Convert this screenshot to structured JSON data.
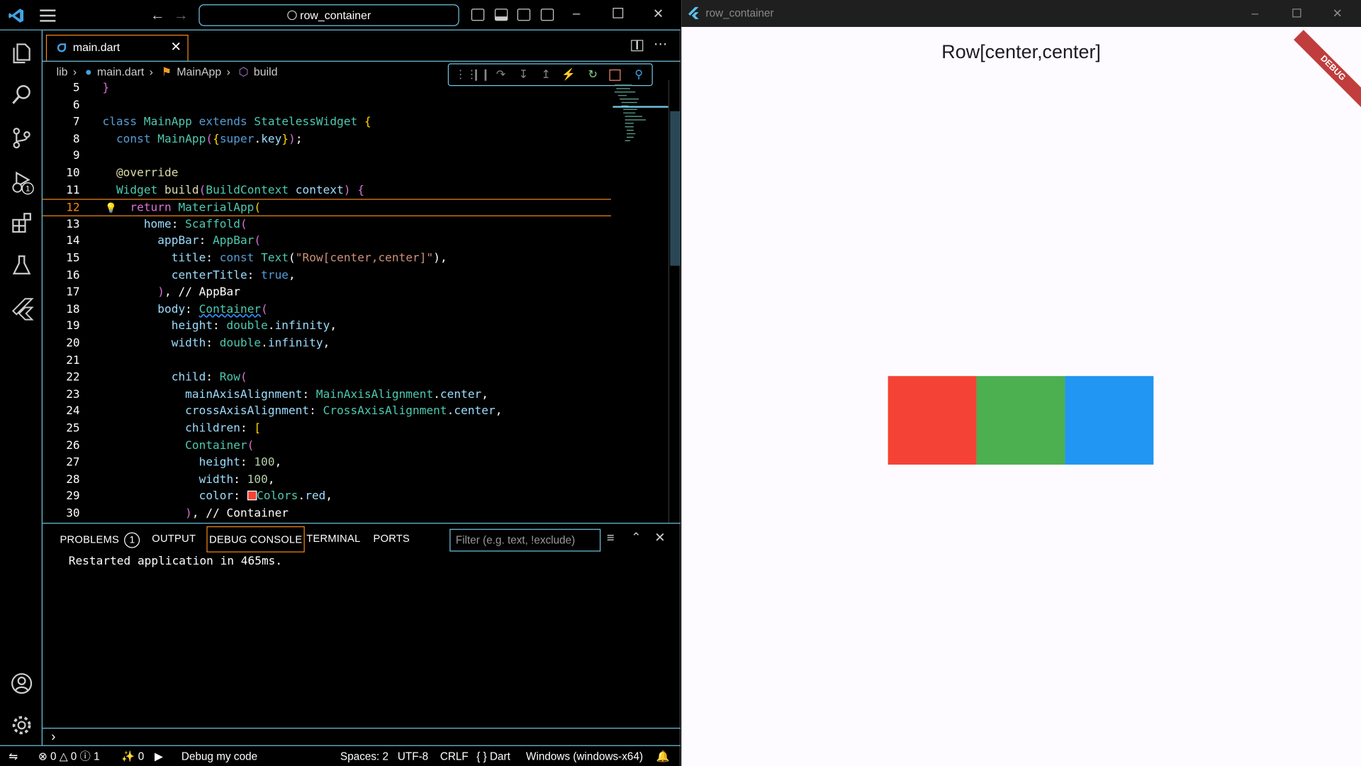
{
  "vscode": {
    "command_center": "row_container",
    "tab": {
      "label": "main.dart"
    },
    "breadcrumb": [
      "lib",
      "main.dart",
      "MainApp",
      "build"
    ],
    "code_lines": [
      {
        "n": "5",
        "html": "<span class=\"br2\">}</span>"
      },
      {
        "n": "6",
        "html": ""
      },
      {
        "n": "7",
        "html": "<span class=\"kw\">class</span> <span class=\"ty\">MainApp</span> <span class=\"kw\">extends</span> <span class=\"ty\">StatelessWidget</span> <span class=\"br\">{</span>"
      },
      {
        "n": "8",
        "html": "  <span class=\"kw\">const</span> <span class=\"ty\">MainApp</span><span class=\"br2\">(</span><span class=\"br\">{</span><span class=\"kw\">super</span>.<span class=\"pr\">key</span><span class=\"br\">}</span><span class=\"br2\">)</span>;"
      },
      {
        "n": "9",
        "html": ""
      },
      {
        "n": "10",
        "html": "  <span class=\"fn\">@override</span>"
      },
      {
        "n": "11",
        "html": "  <span class=\"ty\">Widget</span> <span class=\"fn\">build</span><span class=\"br2\">(</span><span class=\"ty\">BuildContext</span> <span class=\"pr\">context</span><span class=\"br2\">)</span> <span class=\"br2\">{</span>"
      },
      {
        "n": "12",
        "html": "    <span class=\"br2\">return</span> <span class=\"ty\">MaterialApp</span><span class=\"br\">(</span>",
        "current": true
      },
      {
        "n": "13",
        "html": "      <span class=\"pr\">home</span>: <span class=\"ty\">Scaffold</span><span class=\"br2\">(</span>"
      },
      {
        "n": "14",
        "html": "        <span class=\"pr\">appBar</span>: <span class=\"ty\">AppBar</span><span class=\"br2\">(</span>"
      },
      {
        "n": "15",
        "html": "          <span class=\"pr\">title</span>: <span class=\"kw\">const</span> <span class=\"ty\">Text</span>(<span class=\"st\">\"Row[center,center]\"</span>),"
      },
      {
        "n": "16",
        "html": "          <span class=\"pr\">centerTitle</span>: <span class=\"kw\">true</span>,"
      },
      {
        "n": "17",
        "html": "        <span class=\"br2\">)</span>, <span class=\"cm\">// AppBar</span>"
      },
      {
        "n": "18",
        "html": "        <span class=\"pr\">body</span>: <span class=\"ty\" style=\"text-decoration:underline wavy #3794ff\">Container</span><span class=\"br2\">(</span>"
      },
      {
        "n": "19",
        "html": "          <span class=\"pr\">height</span>: <span class=\"ty\">double</span>.<span class=\"pr\">infinity</span>,"
      },
      {
        "n": "20",
        "html": "          <span class=\"pr\">width</span>: <span class=\"ty\">double</span>.<span class=\"pr\">infinity</span>,"
      },
      {
        "n": "21",
        "html": ""
      },
      {
        "n": "22",
        "html": "          <span class=\"pr\">child</span>: <span class=\"ty\">Row</span><span class=\"br2\">(</span>"
      },
      {
        "n": "23",
        "html": "            <span class=\"pr\">mainAxisAlignment</span>: <span class=\"ty\">MainAxisAlignment</span>.<span class=\"pr\">center</span>,"
      },
      {
        "n": "24",
        "html": "            <span class=\"pr\">crossAxisAlignment</span>: <span class=\"ty\">CrossAxisAlignment</span>.<span class=\"pr\">center</span>,"
      },
      {
        "n": "25",
        "html": "            <span class=\"pr\">children</span>: <span class=\"br\">[</span>"
      },
      {
        "n": "26",
        "html": "            <span class=\"ty\">Container</span><span class=\"br2\">(</span>"
      },
      {
        "n": "27",
        "html": "              <span class=\"pr\">height</span>: <span class=\"nm\">100</span>,"
      },
      {
        "n": "28",
        "html": "              <span class=\"pr\">width</span>: <span class=\"nm\">100</span>,"
      },
      {
        "n": "29",
        "html": "              <span class=\"pr\">color</span>: <span style=\"display:inline-block;width:11px;height:11px;background:#f44336;border:1px solid #fff;vertical-align:-1px\"></span><span class=\"ty\">Colors</span>.<span class=\"pr\">red</span>,"
      },
      {
        "n": "30",
        "html": "            <span class=\"br2\">)</span>, <span class=\"cm\">// Container</span>"
      }
    ],
    "panel": {
      "tabs": [
        "PROBLEMS",
        "OUTPUT",
        "DEBUG CONSOLE",
        "TERMINAL",
        "PORTS"
      ],
      "problems_count": "1",
      "filter_placeholder": "Filter (e.g. text, !exclude)",
      "console_output": "Restarted application in 465ms."
    },
    "status": {
      "errors": "0",
      "warnings": "0",
      "info": "1",
      "ports": "0",
      "debug_label": "Debug my code",
      "spaces": "Spaces: 2",
      "encoding": "UTF-8",
      "eol": "CRLF",
      "language": "Dart",
      "device": "Windows (windows-x64)"
    },
    "debug_badge": "1"
  },
  "flutter_app": {
    "window_title": "row_container",
    "app_bar_title": "Row[center,center]",
    "debug_banner": "DEBUG",
    "boxes": [
      {
        "name": "red-box",
        "color": "#f44336"
      },
      {
        "name": "green-box",
        "color": "#4caf50"
      },
      {
        "name": "blue-box",
        "color": "#2196f3"
      }
    ]
  }
}
